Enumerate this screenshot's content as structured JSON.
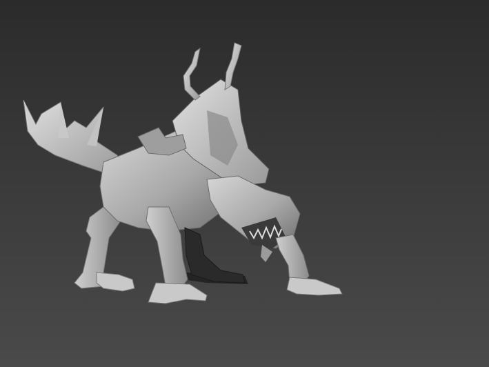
{
  "viewport": {
    "render_style": "untextured grey clay 3D render",
    "background_top": "#2b2b2b",
    "background_bottom": "#4a4a4a",
    "model_color": "#b8b8b8",
    "model_shadow": "#6a6a6a",
    "model_highlight": "#d9d9d9",
    "subject": "horned-dragon-beast-model"
  }
}
